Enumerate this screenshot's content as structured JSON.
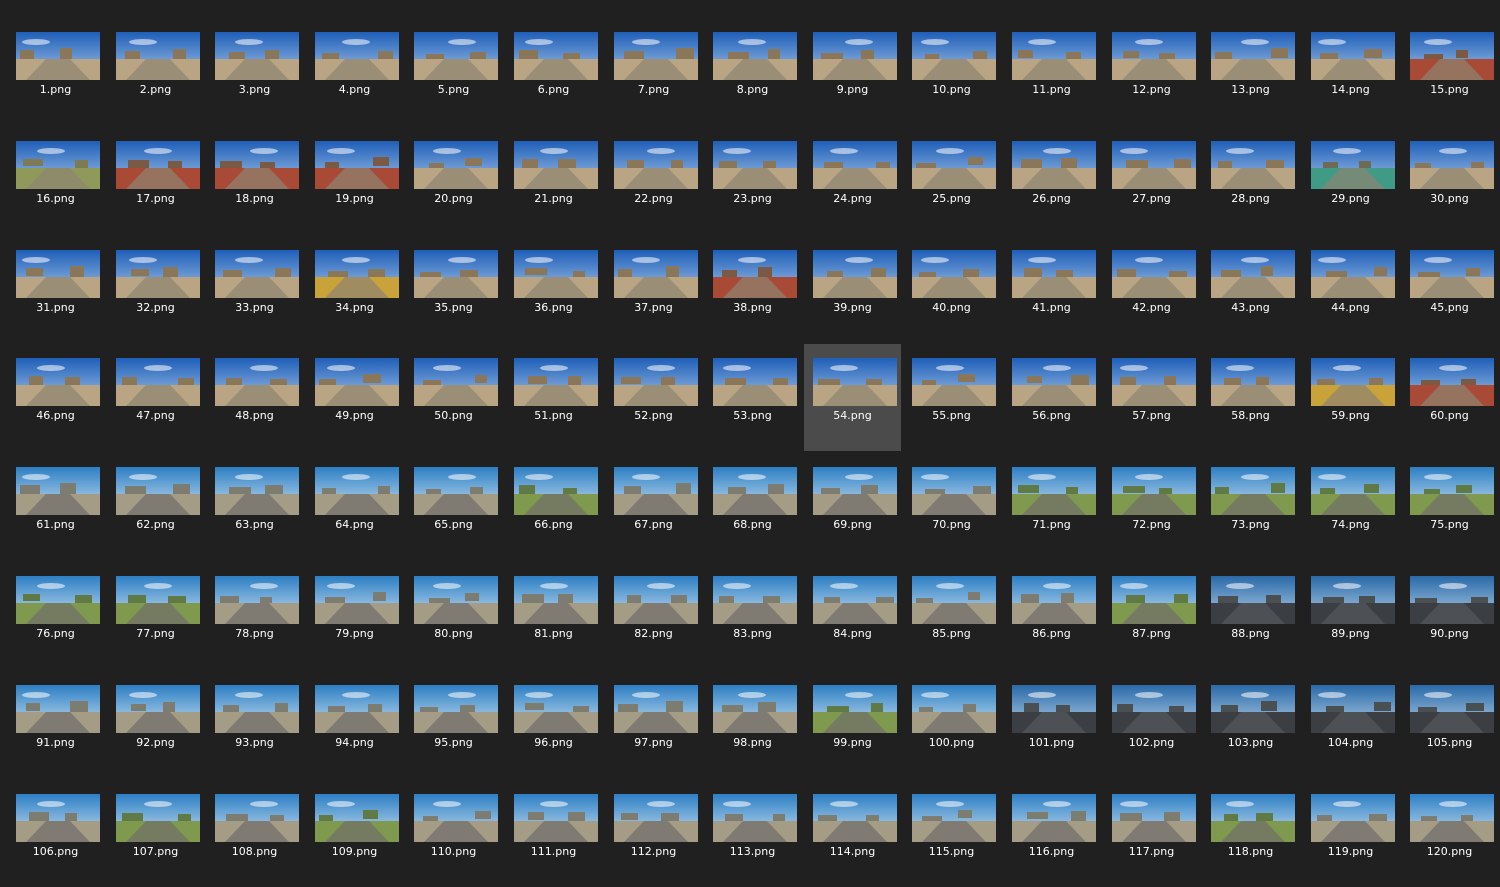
{
  "file_view": {
    "selected_file": "54.png",
    "icon_kind": "image-thumbnail",
    "colors": {
      "background": "#202020",
      "selection": "#4b4b4b",
      "label_text": "#ffffff"
    },
    "files": [
      {
        "name": "1.png",
        "scene": "desert"
      },
      {
        "name": "2.png",
        "scene": "desert"
      },
      {
        "name": "3.png",
        "scene": "desert"
      },
      {
        "name": "4.png",
        "scene": "desert"
      },
      {
        "name": "5.png",
        "scene": "desert"
      },
      {
        "name": "6.png",
        "scene": "desert"
      },
      {
        "name": "7.png",
        "scene": "desert"
      },
      {
        "name": "8.png",
        "scene": "desert"
      },
      {
        "name": "9.png",
        "scene": "desert"
      },
      {
        "name": "10.png",
        "scene": "desert"
      },
      {
        "name": "11.png",
        "scene": "desert"
      },
      {
        "name": "12.png",
        "scene": "desert"
      },
      {
        "name": "13.png",
        "scene": "desert"
      },
      {
        "name": "14.png",
        "scene": "desert"
      },
      {
        "name": "15.png",
        "scene": "desert-red"
      },
      {
        "name": "16.png",
        "scene": "desert-green"
      },
      {
        "name": "17.png",
        "scene": "desert-red"
      },
      {
        "name": "18.png",
        "scene": "desert-red"
      },
      {
        "name": "19.png",
        "scene": "desert-red"
      },
      {
        "name": "20.png",
        "scene": "desert"
      },
      {
        "name": "21.png",
        "scene": "desert"
      },
      {
        "name": "22.png",
        "scene": "desert"
      },
      {
        "name": "23.png",
        "scene": "desert"
      },
      {
        "name": "24.png",
        "scene": "desert"
      },
      {
        "name": "25.png",
        "scene": "desert"
      },
      {
        "name": "26.png",
        "scene": "desert"
      },
      {
        "name": "27.png",
        "scene": "desert"
      },
      {
        "name": "28.png",
        "scene": "desert"
      },
      {
        "name": "29.png",
        "scene": "desert-teal"
      },
      {
        "name": "30.png",
        "scene": "desert"
      },
      {
        "name": "31.png",
        "scene": "desert"
      },
      {
        "name": "32.png",
        "scene": "desert"
      },
      {
        "name": "33.png",
        "scene": "desert"
      },
      {
        "name": "34.png",
        "scene": "desert-yellow"
      },
      {
        "name": "35.png",
        "scene": "desert"
      },
      {
        "name": "36.png",
        "scene": "desert"
      },
      {
        "name": "37.png",
        "scene": "desert"
      },
      {
        "name": "38.png",
        "scene": "desert-red"
      },
      {
        "name": "39.png",
        "scene": "desert"
      },
      {
        "name": "40.png",
        "scene": "desert"
      },
      {
        "name": "41.png",
        "scene": "desert"
      },
      {
        "name": "42.png",
        "scene": "desert"
      },
      {
        "name": "43.png",
        "scene": "desert"
      },
      {
        "name": "44.png",
        "scene": "desert"
      },
      {
        "name": "45.png",
        "scene": "desert"
      },
      {
        "name": "46.png",
        "scene": "desert"
      },
      {
        "name": "47.png",
        "scene": "desert"
      },
      {
        "name": "48.png",
        "scene": "desert"
      },
      {
        "name": "49.png",
        "scene": "desert"
      },
      {
        "name": "50.png",
        "scene": "desert"
      },
      {
        "name": "51.png",
        "scene": "desert"
      },
      {
        "name": "52.png",
        "scene": "desert"
      },
      {
        "name": "53.png",
        "scene": "desert"
      },
      {
        "name": "54.png",
        "scene": "desert"
      },
      {
        "name": "55.png",
        "scene": "desert"
      },
      {
        "name": "56.png",
        "scene": "desert"
      },
      {
        "name": "57.png",
        "scene": "desert"
      },
      {
        "name": "58.png",
        "scene": "desert"
      },
      {
        "name": "59.png",
        "scene": "desert-yellow"
      },
      {
        "name": "60.png",
        "scene": "desert-red"
      },
      {
        "name": "61.png",
        "scene": "coast"
      },
      {
        "name": "62.png",
        "scene": "coast"
      },
      {
        "name": "63.png",
        "scene": "coast"
      },
      {
        "name": "64.png",
        "scene": "coast"
      },
      {
        "name": "65.png",
        "scene": "coast"
      },
      {
        "name": "66.png",
        "scene": "coast-green"
      },
      {
        "name": "67.png",
        "scene": "coast"
      },
      {
        "name": "68.png",
        "scene": "coast"
      },
      {
        "name": "69.png",
        "scene": "coast"
      },
      {
        "name": "70.png",
        "scene": "coast"
      },
      {
        "name": "71.png",
        "scene": "coast-green"
      },
      {
        "name": "72.png",
        "scene": "coast-green"
      },
      {
        "name": "73.png",
        "scene": "coast-green"
      },
      {
        "name": "74.png",
        "scene": "coast-green"
      },
      {
        "name": "75.png",
        "scene": "coast-green"
      },
      {
        "name": "76.png",
        "scene": "coast-green"
      },
      {
        "name": "77.png",
        "scene": "coast-green"
      },
      {
        "name": "78.png",
        "scene": "coast"
      },
      {
        "name": "79.png",
        "scene": "coast"
      },
      {
        "name": "80.png",
        "scene": "coast"
      },
      {
        "name": "81.png",
        "scene": "coast"
      },
      {
        "name": "82.png",
        "scene": "coast"
      },
      {
        "name": "83.png",
        "scene": "coast"
      },
      {
        "name": "84.png",
        "scene": "coast"
      },
      {
        "name": "85.png",
        "scene": "coast"
      },
      {
        "name": "86.png",
        "scene": "coast"
      },
      {
        "name": "87.png",
        "scene": "coast-green"
      },
      {
        "name": "88.png",
        "scene": "coast-dark"
      },
      {
        "name": "89.png",
        "scene": "coast-dark"
      },
      {
        "name": "90.png",
        "scene": "coast-dark"
      },
      {
        "name": "91.png",
        "scene": "coast"
      },
      {
        "name": "92.png",
        "scene": "coast"
      },
      {
        "name": "93.png",
        "scene": "coast"
      },
      {
        "name": "94.png",
        "scene": "coast"
      },
      {
        "name": "95.png",
        "scene": "coast"
      },
      {
        "name": "96.png",
        "scene": "coast"
      },
      {
        "name": "97.png",
        "scene": "coast"
      },
      {
        "name": "98.png",
        "scene": "coast"
      },
      {
        "name": "99.png",
        "scene": "coast-green"
      },
      {
        "name": "100.png",
        "scene": "coast"
      },
      {
        "name": "101.png",
        "scene": "coast-dark"
      },
      {
        "name": "102.png",
        "scene": "coast-dark"
      },
      {
        "name": "103.png",
        "scene": "coast-dark"
      },
      {
        "name": "104.png",
        "scene": "coast-dark"
      },
      {
        "name": "105.png",
        "scene": "coast-dark"
      },
      {
        "name": "106.png",
        "scene": "coast"
      },
      {
        "name": "107.png",
        "scene": "coast-green"
      },
      {
        "name": "108.png",
        "scene": "coast"
      },
      {
        "name": "109.png",
        "scene": "coast-green"
      },
      {
        "name": "110.png",
        "scene": "coast"
      },
      {
        "name": "111.png",
        "scene": "coast"
      },
      {
        "name": "112.png",
        "scene": "coast"
      },
      {
        "name": "113.png",
        "scene": "coast"
      },
      {
        "name": "114.png",
        "scene": "coast"
      },
      {
        "name": "115.png",
        "scene": "coast"
      },
      {
        "name": "116.png",
        "scene": "coast"
      },
      {
        "name": "117.png",
        "scene": "coast"
      },
      {
        "name": "118.png",
        "scene": "coast-green"
      },
      {
        "name": "119.png",
        "scene": "coast"
      },
      {
        "name": "120.png",
        "scene": "coast"
      }
    ]
  }
}
